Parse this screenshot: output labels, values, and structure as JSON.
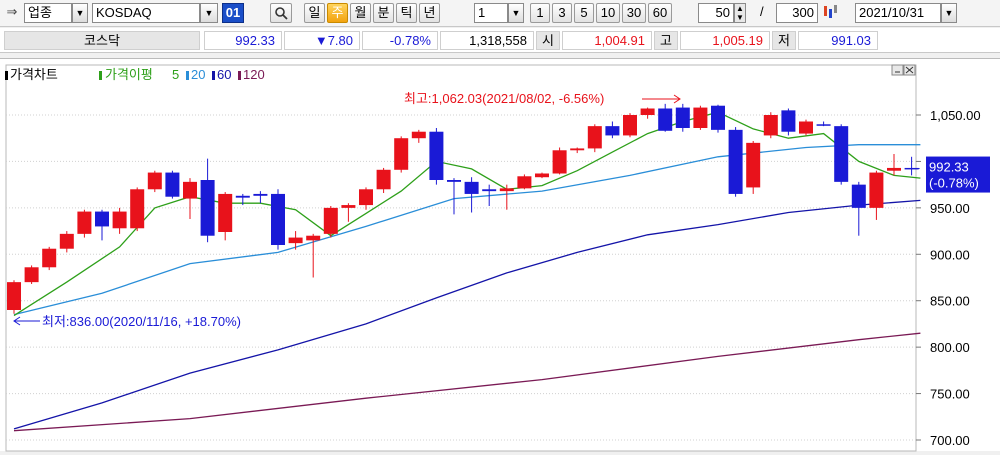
{
  "toolbar": {
    "category_select": "업종",
    "code_input": "KOSDAQ",
    "code_badge": "01",
    "search_icon": "search-icon",
    "period_buttons": [
      "일",
      "주",
      "월",
      "분",
      "틱",
      "년"
    ],
    "active_period": "주",
    "interval_select": "1",
    "minute_buttons": [
      "1",
      "3",
      "5",
      "10",
      "30",
      "60"
    ],
    "count_value": "50",
    "separator": "/",
    "total_value": "300",
    "date_value": "2021/10/31"
  },
  "quote": {
    "name": "코스닥",
    "price": "992.33",
    "change": "▼7.80",
    "change_pct": "-0.78%",
    "volume": "1,318,558",
    "open_label": "시",
    "open": "1,004.91",
    "high_label": "고",
    "high": "1,005.19",
    "low_label": "저",
    "low": "991.03"
  },
  "colors": {
    "up": "#e8121b",
    "down": "#1a1ad6",
    "ma5": "#2ea01a",
    "ma20": "#2a8ed8",
    "ma60": "#1414a8",
    "ma120": "#7a1a55",
    "price_tag_bg": "#1a1ad6"
  },
  "chart_data": {
    "type": "candlestick",
    "legend": {
      "title": "가격차트",
      "ma_label": "가격이평",
      "periods": [
        "5",
        "20",
        "60",
        "120"
      ]
    },
    "annotations": {
      "max": "최고:1,062.03(2021/08/02, -6.56%)",
      "min": "최저:836.00(2020/11/16, +18.70%)"
    },
    "price_tag": [
      "992.33",
      "(-0.78%)"
    ],
    "ylim": [
      700,
      1085
    ],
    "yticks": [
      "1,050.00",
      "1,000.00",
      "950.00",
      "900.00",
      "850.00",
      "800.00",
      "750.00",
      "700.00"
    ],
    "ytick_values": [
      1050,
      1000,
      950,
      900,
      850,
      800,
      750,
      700
    ],
    "candles": [
      {
        "o": 840,
        "h": 872,
        "l": 836,
        "c": 870
      },
      {
        "o": 870,
        "h": 888,
        "l": 868,
        "c": 886
      },
      {
        "o": 886,
        "h": 908,
        "l": 883,
        "c": 906
      },
      {
        "o": 906,
        "h": 925,
        "l": 902,
        "c": 922
      },
      {
        "o": 922,
        "h": 948,
        "l": 918,
        "c": 946
      },
      {
        "o": 946,
        "h": 948,
        "l": 915,
        "c": 930
      },
      {
        "o": 928,
        "h": 950,
        "l": 922,
        "c": 946
      },
      {
        "o": 928,
        "h": 972,
        "l": 925,
        "c": 970
      },
      {
        "o": 970,
        "h": 990,
        "l": 967,
        "c": 988
      },
      {
        "o": 988,
        "h": 990,
        "l": 960,
        "c": 962
      },
      {
        "o": 960,
        "h": 982,
        "l": 938,
        "c": 978
      },
      {
        "o": 980,
        "h": 1003,
        "l": 913,
        "c": 920
      },
      {
        "o": 924,
        "h": 967,
        "l": 915,
        "c": 965
      },
      {
        "o": 963,
        "h": 965,
        "l": 953,
        "c": 961
      },
      {
        "o": 965,
        "h": 968,
        "l": 955,
        "c": 963
      },
      {
        "o": 965,
        "h": 970,
        "l": 905,
        "c": 910
      },
      {
        "o": 912,
        "h": 925,
        "l": 905,
        "c": 918
      },
      {
        "o": 915,
        "h": 922,
        "l": 875,
        "c": 920
      },
      {
        "o": 922,
        "h": 952,
        "l": 918,
        "c": 950
      },
      {
        "o": 950,
        "h": 955,
        "l": 935,
        "c": 953
      },
      {
        "o": 953,
        "h": 972,
        "l": 948,
        "c": 970
      },
      {
        "o": 970,
        "h": 993,
        "l": 966,
        "c": 991
      },
      {
        "o": 991,
        "h": 1027,
        "l": 988,
        "c": 1025
      },
      {
        "o": 1025,
        "h": 1034,
        "l": 1020,
        "c": 1032
      },
      {
        "o": 1032,
        "h": 1036,
        "l": 975,
        "c": 980
      },
      {
        "o": 980,
        "h": 982,
        "l": 943,
        "c": 978
      },
      {
        "o": 978,
        "h": 983,
        "l": 945,
        "c": 965
      },
      {
        "o": 970,
        "h": 975,
        "l": 952,
        "c": 968
      },
      {
        "o": 968,
        "h": 975,
        "l": 948,
        "c": 971
      },
      {
        "o": 971,
        "h": 986,
        "l": 970,
        "c": 984
      },
      {
        "o": 983,
        "h": 988,
        "l": 982,
        "c": 987
      },
      {
        "o": 987,
        "h": 1015,
        "l": 986,
        "c": 1012
      },
      {
        "o": 1012,
        "h": 1015,
        "l": 1009,
        "c": 1014
      },
      {
        "o": 1014,
        "h": 1040,
        "l": 1010,
        "c": 1038
      },
      {
        "o": 1038,
        "h": 1043,
        "l": 1025,
        "c": 1028
      },
      {
        "o": 1028,
        "h": 1052,
        "l": 1026,
        "c": 1050
      },
      {
        "o": 1050,
        "h": 1058,
        "l": 1046,
        "c": 1057
      },
      {
        "o": 1057,
        "h": 1062,
        "l": 1032,
        "c": 1033
      },
      {
        "o": 1058,
        "h": 1062,
        "l": 1032,
        "c": 1036
      },
      {
        "o": 1036,
        "h": 1060,
        "l": 1034,
        "c": 1058
      },
      {
        "o": 1060,
        "h": 1061,
        "l": 1031,
        "c": 1034
      },
      {
        "o": 1034,
        "h": 1037,
        "l": 962,
        "c": 965
      },
      {
        "o": 972,
        "h": 1022,
        "l": 965,
        "c": 1020
      },
      {
        "o": 1028,
        "h": 1053,
        "l": 1025,
        "c": 1050
      },
      {
        "o": 1055,
        "h": 1057,
        "l": 1028,
        "c": 1032
      },
      {
        "o": 1030,
        "h": 1045,
        "l": 1028,
        "c": 1043
      },
      {
        "o": 1040,
        "h": 1043,
        "l": 1038,
        "c": 1039
      },
      {
        "o": 1038,
        "h": 1040,
        "l": 975,
        "c": 978
      },
      {
        "o": 975,
        "h": 978,
        "l": 920,
        "c": 950
      },
      {
        "o": 950,
        "h": 990,
        "l": 937,
        "c": 988
      },
      {
        "o": 990,
        "h": 1008,
        "l": 985,
        "c": 993
      },
      {
        "o": 993,
        "h": 1005,
        "l": 985,
        "c": 992
      }
    ],
    "ma5": [
      [
        0,
        834
      ],
      [
        3,
        870
      ],
      [
        6,
        908
      ],
      [
        8,
        950
      ],
      [
        10,
        962
      ],
      [
        12,
        955
      ],
      [
        14,
        955
      ],
      [
        16,
        948
      ],
      [
        18,
        920
      ],
      [
        20,
        944
      ],
      [
        22,
        968
      ],
      [
        24,
        1000
      ],
      [
        26,
        992
      ],
      [
        28,
        970
      ],
      [
        30,
        974
      ],
      [
        32,
        990
      ],
      [
        34,
        1010
      ],
      [
        36,
        1030
      ],
      [
        38,
        1043
      ],
      [
        40,
        1053
      ],
      [
        42,
        1035
      ],
      [
        44,
        1025
      ],
      [
        46,
        1030
      ],
      [
        48,
        1000
      ],
      [
        50,
        985
      ],
      [
        51.5,
        982
      ]
    ],
    "ma20": [
      [
        0,
        835
      ],
      [
        5,
        858
      ],
      [
        10,
        890
      ],
      [
        15,
        902
      ],
      [
        20,
        930
      ],
      [
        25,
        960
      ],
      [
        30,
        968
      ],
      [
        35,
        985
      ],
      [
        40,
        1005
      ],
      [
        45,
        1015
      ],
      [
        48,
        1018
      ],
      [
        51.5,
        1018
      ]
    ],
    "ma60": [
      [
        0,
        712
      ],
      [
        5,
        740
      ],
      [
        10,
        772
      ],
      [
        15,
        797
      ],
      [
        20,
        825
      ],
      [
        24,
        853
      ],
      [
        28,
        880
      ],
      [
        32,
        902
      ],
      [
        36,
        921
      ],
      [
        40,
        932
      ],
      [
        44,
        945
      ],
      [
        48,
        953
      ],
      [
        51.5,
        958
      ]
    ],
    "ma120": [
      [
        0,
        710
      ],
      [
        10,
        723
      ],
      [
        20,
        745
      ],
      [
        30,
        765
      ],
      [
        40,
        790
      ],
      [
        48,
        808
      ],
      [
        51.5,
        815
      ]
    ]
  }
}
